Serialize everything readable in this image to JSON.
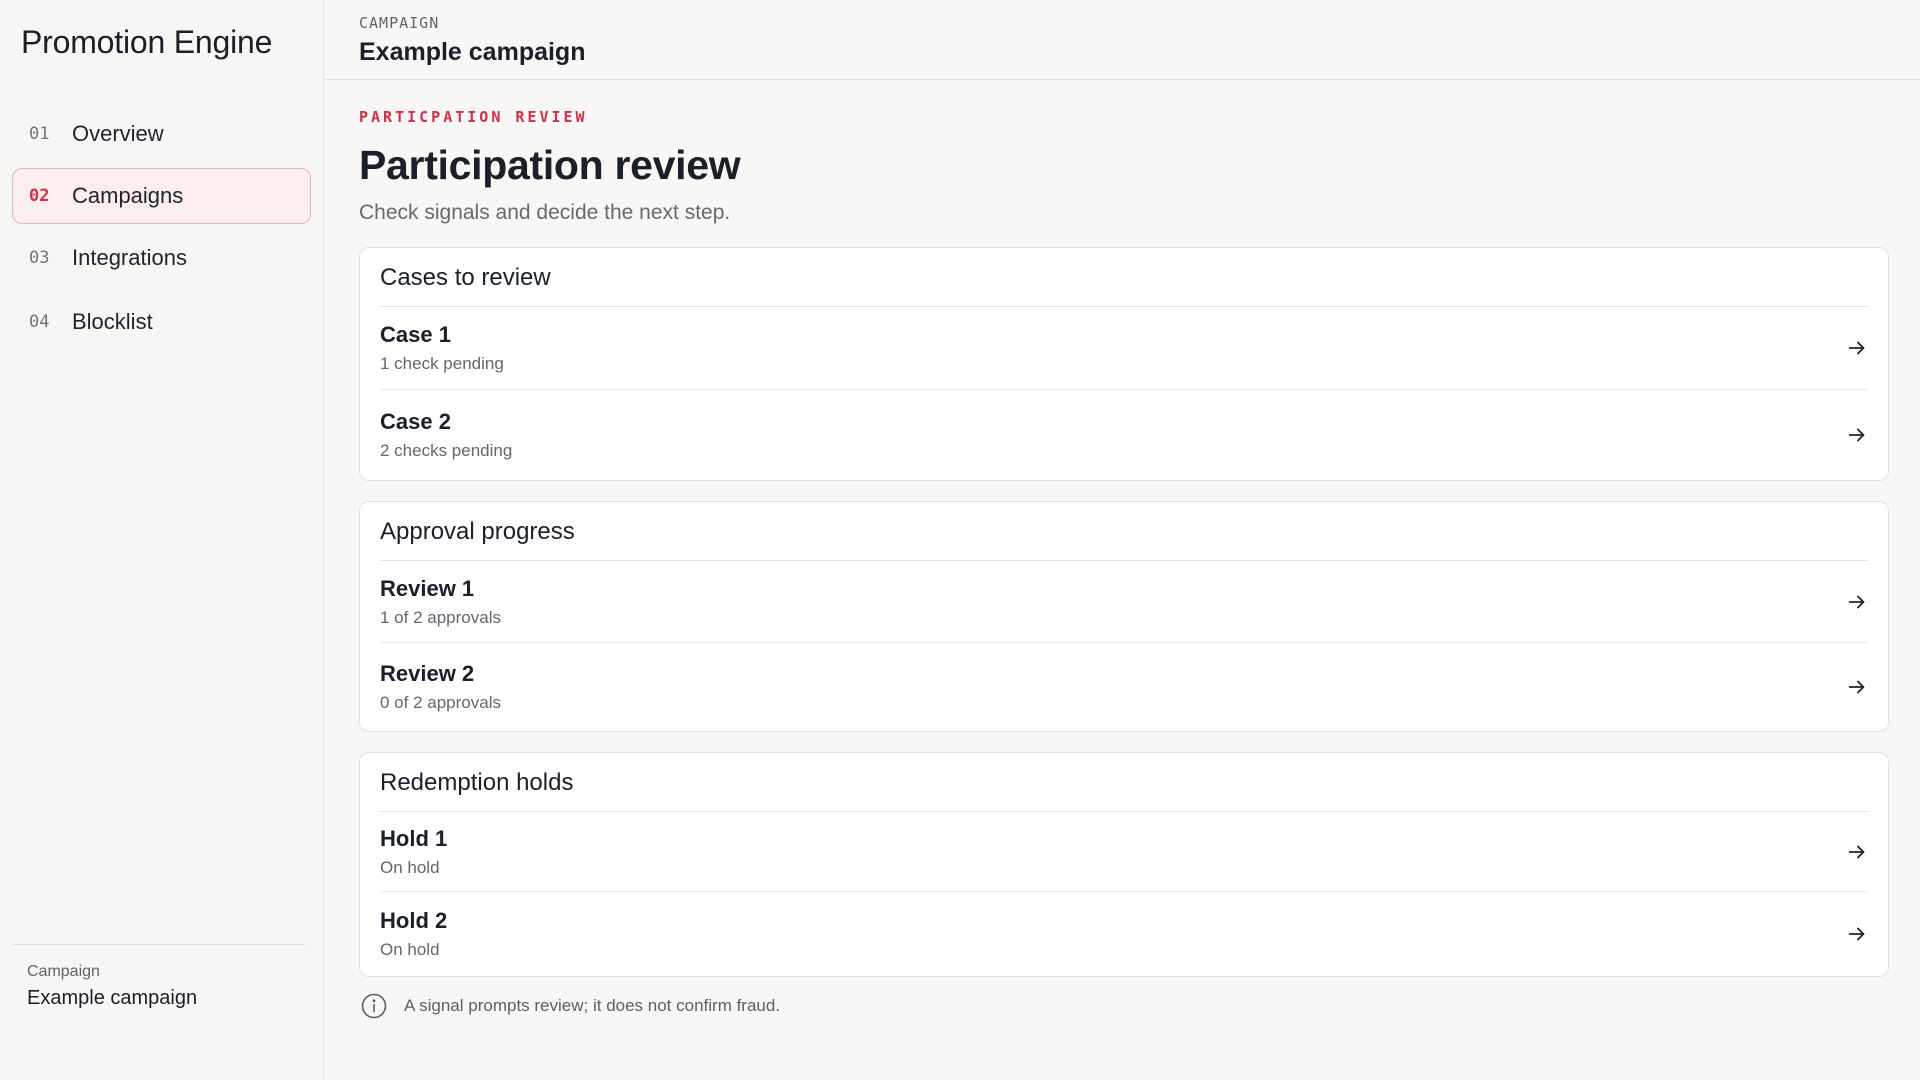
{
  "app": {
    "title": "Promotion Engine"
  },
  "sidebar": {
    "items": [
      {
        "num": "01",
        "label": "Overview"
      },
      {
        "num": "02",
        "label": "Campaigns"
      },
      {
        "num": "03",
        "label": "Integrations"
      },
      {
        "num": "04",
        "label": "Blocklist"
      }
    ],
    "active_index": 1,
    "footer": {
      "label": "Campaign",
      "value": "Example campaign"
    }
  },
  "header": {
    "crumb_label": "CAMPAIGN",
    "title": "Example campaign"
  },
  "page": {
    "eyebrow": "PARTICPATION REVIEW",
    "title": "Participation review",
    "subtitle": "Check signals and decide the next step."
  },
  "sections": [
    {
      "title": "Cases to review",
      "rows": [
        {
          "title": "Case 1",
          "sub": "1 check pending"
        },
        {
          "title": "Case 2",
          "sub": "2 checks pending"
        }
      ]
    },
    {
      "title": "Approval progress",
      "rows": [
        {
          "title": "Review 1",
          "sub": "1 of 2 approvals"
        },
        {
          "title": "Review 2",
          "sub": "0 of 2 approvals"
        }
      ]
    },
    {
      "title": "Redemption holds",
      "rows": [
        {
          "title": "Hold 1",
          "sub": "On hold"
        },
        {
          "title": "Hold 2",
          "sub": "On hold"
        }
      ]
    }
  ],
  "note": {
    "icon": "info-icon",
    "text": "A signal prompts review; it does not confirm fraud."
  },
  "icons": {
    "row_action": "arrow-right-icon"
  },
  "colors": {
    "accent": "#d0304a",
    "active_bg": "#fdeeee",
    "active_border": "#eab3b8"
  }
}
